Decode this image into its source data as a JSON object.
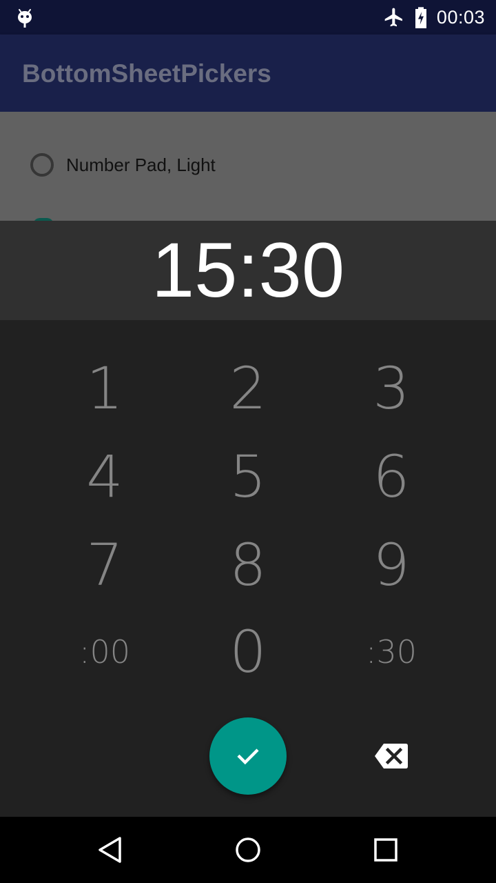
{
  "status_bar": {
    "time": "00:03",
    "icons": [
      "android-debug-icon",
      "airplane-mode-icon",
      "battery-charging-icon"
    ]
  },
  "app_bar": {
    "title": "BottomSheetPickers"
  },
  "options": [
    {
      "label": "Number Pad, Light",
      "selected": false
    }
  ],
  "picker": {
    "time": "15:30",
    "keys": [
      {
        "label": "1"
      },
      {
        "label": "2"
      },
      {
        "label": "3"
      },
      {
        "label": "4"
      },
      {
        "label": "5"
      },
      {
        "label": "6"
      },
      {
        "label": "7"
      },
      {
        "label": "8"
      },
      {
        "label": "9"
      },
      {
        "label": ":00"
      },
      {
        "label": "0"
      },
      {
        "label": ":30"
      }
    ],
    "confirm_icon": "check-icon",
    "backspace_icon": "backspace-icon",
    "accent_color": "#009688"
  },
  "nav_bar": {
    "icons": [
      "back-icon",
      "home-icon",
      "recents-icon"
    ]
  },
  "colors": {
    "status_bar": "#0f1436",
    "app_bar_dimmed": "#19204a",
    "sheet_header": "#303030",
    "keypad": "#212121"
  }
}
